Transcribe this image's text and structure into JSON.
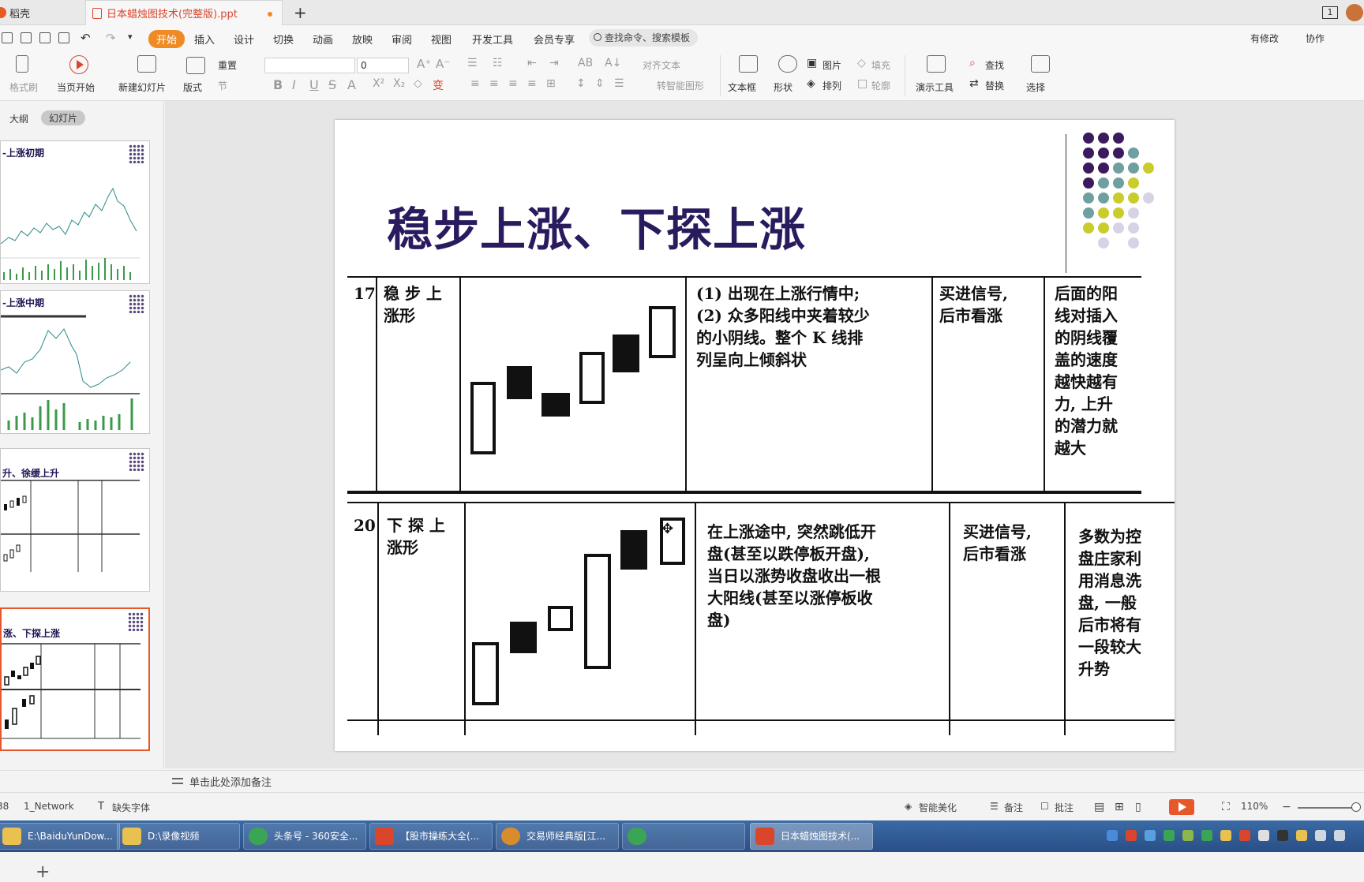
{
  "window": {
    "tabs": [
      {
        "label": "稻壳"
      },
      {
        "label": "日本蜡烛图技术(完整版).ppt"
      }
    ],
    "tab_count": "1"
  },
  "menu": {
    "items": [
      "开始",
      "插入",
      "设计",
      "切换",
      "动画",
      "放映",
      "审阅",
      "视图",
      "开发工具",
      "会员专享"
    ],
    "search_placeholder": "查找命令、搜索模板",
    "right_links": [
      "有修改",
      "协作"
    ]
  },
  "ribbon": {
    "format_painter": "格式刷",
    "play_from_current": "当页开始",
    "new_slide": "新建幻灯片",
    "layout": "版式",
    "reset": "重置",
    "section": "节",
    "font_size": "0",
    "align_text": "对齐文本",
    "convert_smartart": "转智能图形",
    "textbox": "文本框",
    "shape": "形状",
    "picture": "图片",
    "fill": "填充",
    "arrange": "排列",
    "outline": "轮廓",
    "presentation_tools": "演示工具",
    "find": "查找",
    "replace": "替换",
    "select": "选择"
  },
  "left_panel": {
    "tabs": [
      "大纲",
      "幻灯片"
    ],
    "thumbnails": [
      {
        "title": "-上涨初期"
      },
      {
        "title": "-上涨中期"
      },
      {
        "title": "升、徐缓上升"
      },
      {
        "title": "涨、下探上涨"
      }
    ]
  },
  "slide": {
    "title": "稳步上涨、下探上涨",
    "rows": [
      {
        "num": "17",
        "name_line1": "稳 步 上",
        "name_line2": "涨形",
        "desc": [
          "(1) 出现在上涨行情中;",
          "(2) 众多阳线中夹着较少",
          "的小阴线。整个 K 线排",
          "列呈向上倾斜状"
        ],
        "signal": [
          "买进信号,",
          "后市看涨"
        ],
        "note": [
          "后面的阳",
          "线对插入",
          "的阴线覆",
          "盖的速度",
          "越快越有",
          "力, 上升",
          "的潜力就",
          "越大"
        ]
      },
      {
        "num": "20",
        "name_line1": "下 探 上",
        "name_line2": "涨形",
        "desc": [
          "在上涨途中, 突然跳低开",
          "盘(甚至以跌停板开盘),",
          "当日以涨势收盘收出一根",
          "大阳线(甚至以涨停板收",
          "盘)"
        ],
        "signal": [
          "买进信号,",
          "后市看涨"
        ],
        "note": [
          "多数为控",
          "盘庄家利",
          "用消息洗",
          "盘, 一般",
          "后市将有",
          "一段较大",
          "升势"
        ]
      }
    ],
    "accent_colors": [
      "#3b1a5e",
      "#6f9fa0",
      "#c9cc2a",
      "#d6d3e6"
    ]
  },
  "notes": {
    "placeholder": "单击此处添加备注"
  },
  "status": {
    "slide_num": "38",
    "theme": "1_Network",
    "missing_font": "缺失字体",
    "smart_beautify": "智能美化",
    "notes_btn": "备注",
    "comments": "批注",
    "zoom": "110%"
  },
  "taskbar": {
    "items": [
      {
        "label": "E:\\BaiduYunDow...",
        "color": "#e8c150"
      },
      {
        "label": "D:\\录像视频",
        "color": "#e8c150"
      },
      {
        "label": "头条号 - 360安全...",
        "color": "#3aa655"
      },
      {
        "label": "【股市操练大全(...",
        "color": "#d9462c"
      },
      {
        "label": "交易师经典版[江...",
        "color": "#d98c2c"
      },
      {
        "label": "",
        "color": "#3aa655"
      },
      {
        "label": "日本蜡烛图技术(...",
        "color": "#d9462c"
      }
    ]
  }
}
